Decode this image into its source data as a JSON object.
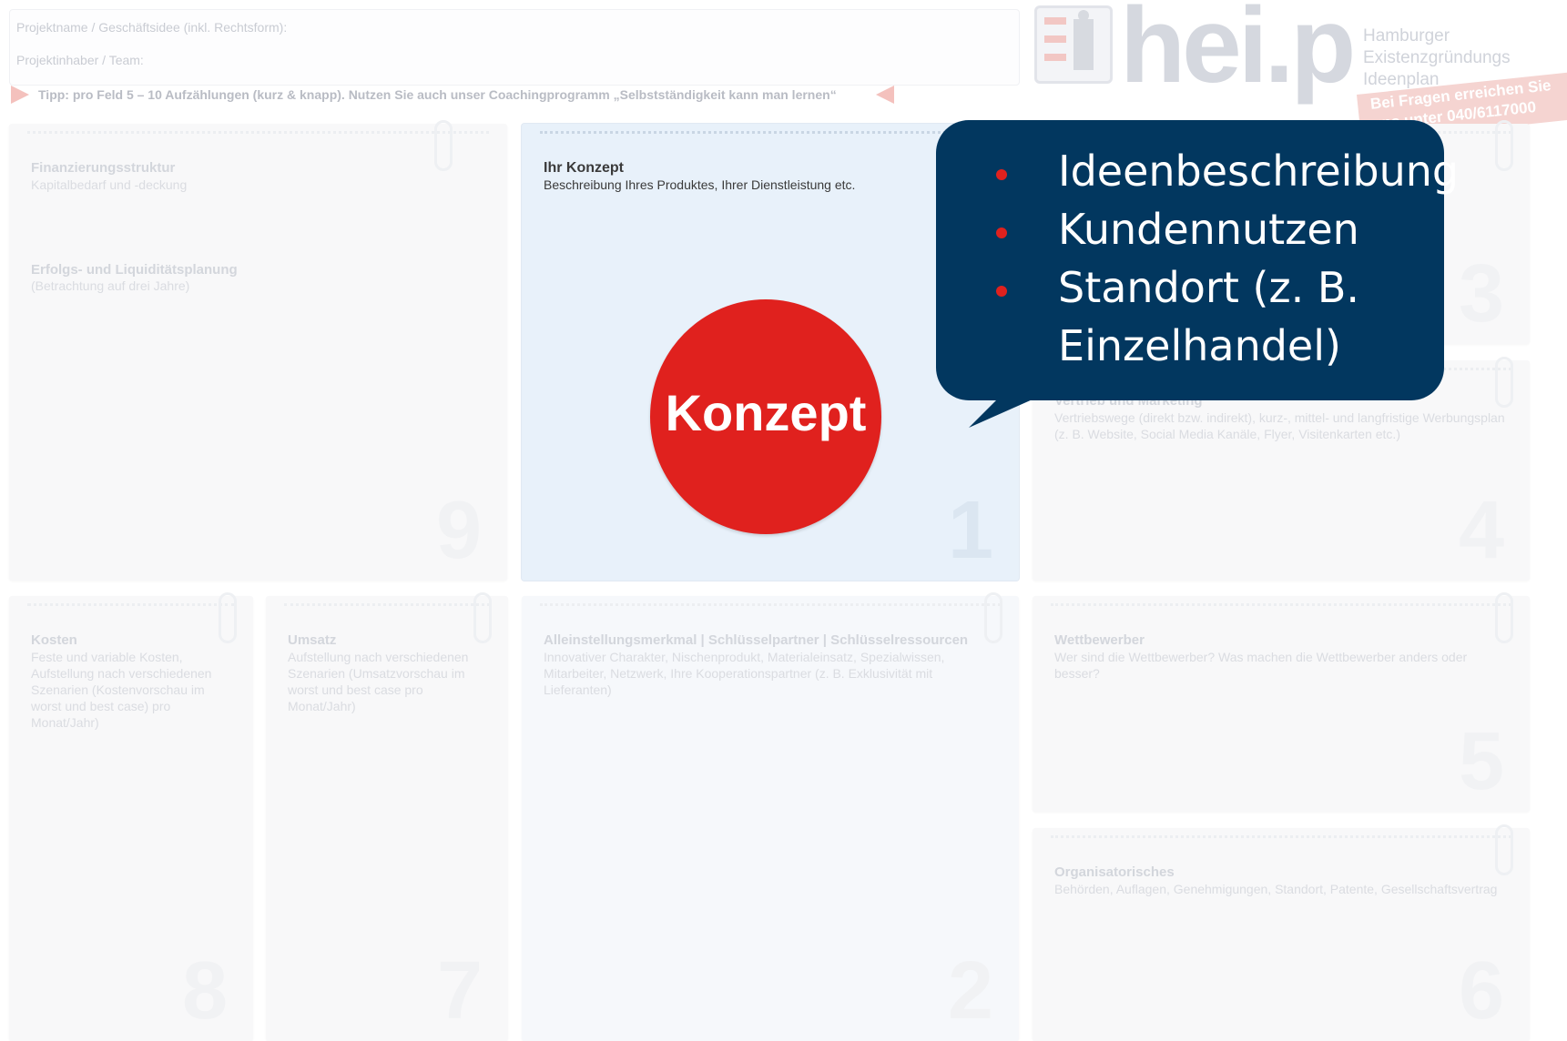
{
  "header": {
    "project_name_label": "Projektname / Geschäftsidee (inkl. Rechtsform):",
    "owner_label": "Projektinhaber / Team:",
    "tip": "Tipp: pro Feld 5 – 10 Aufzählungen (kurz & knapp). Nutzen Sie auch unser Coachingprogramm „Selbstständigkeit kann man lernen“"
  },
  "logo": {
    "text": "hei.p",
    "subtitle": [
      "Hamburger",
      "Existenzgründungs",
      "Ideenplan"
    ],
    "ribbon": [
      "Bei Fragen erreichen Sie",
      "uns unter 040/6117000"
    ]
  },
  "cards": [
    {
      "id": "9",
      "title": "Finanzierungsstruktur",
      "subtitle": "Kapitalbedarf und -deckung",
      "title2": "Erfolgs- und Liquiditätsplanung",
      "subtitle2": "(Betrachtung auf drei Jahre)"
    },
    {
      "id": "1",
      "title": "Ihr Konzept",
      "subtitle": "Beschreibung Ihres Produktes, Ihrer Dienstleistung etc."
    },
    {
      "id": "3",
      "title": "",
      "subtitle": ""
    },
    {
      "id": "4",
      "title": "Vertrieb und Marketing",
      "subtitle": "Vertriebswege (direkt bzw. indirekt), kurz-, mittel- und langfristige Werbungsplan (z. B. Website, Social Media Kanäle, Flyer, Visitenkarten etc.)"
    },
    {
      "id": "8",
      "title": "Kosten",
      "subtitle": "Feste und variable Kosten, Aufstellung nach verschiedenen Szenarien (Kostenvorschau im worst und best case) pro Monat/Jahr)"
    },
    {
      "id": "7",
      "title": "Umsatz",
      "subtitle": "Aufstellung nach verschiedenen Szenarien (Umsatzvorschau im worst und best case pro Monat/Jahr)"
    },
    {
      "id": "2",
      "title": "Alleinstellungsmerkmal | Schlüsselpartner | Schlüsselressourcen",
      "subtitle": "Innovativer Charakter, Nischenprodukt, Materialeinsatz, Spezialwissen, Mitarbeiter, Netzwerk, Ihre Kooperationspartner (z. B. Exklusivität mit Lieferanten)"
    },
    {
      "id": "5",
      "title": "Wettbewerber",
      "subtitle": "Wer sind die Wettbewerber? Was machen die Wettbewerber anders oder besser?"
    },
    {
      "id": "6",
      "title": "Organisatorisches",
      "subtitle": "Behörden, Auflagen, Genehmigungen, Standort, Patente, Gesellschaftsvertrag"
    }
  ],
  "highlight": {
    "label": "Konzept",
    "color": "#e0211e"
  },
  "bubble": {
    "color": "#02375f",
    "items": [
      "Ideenbeschreibung",
      "Kundennutzen",
      "Standort (z. B. Einzelhandel)"
    ]
  }
}
